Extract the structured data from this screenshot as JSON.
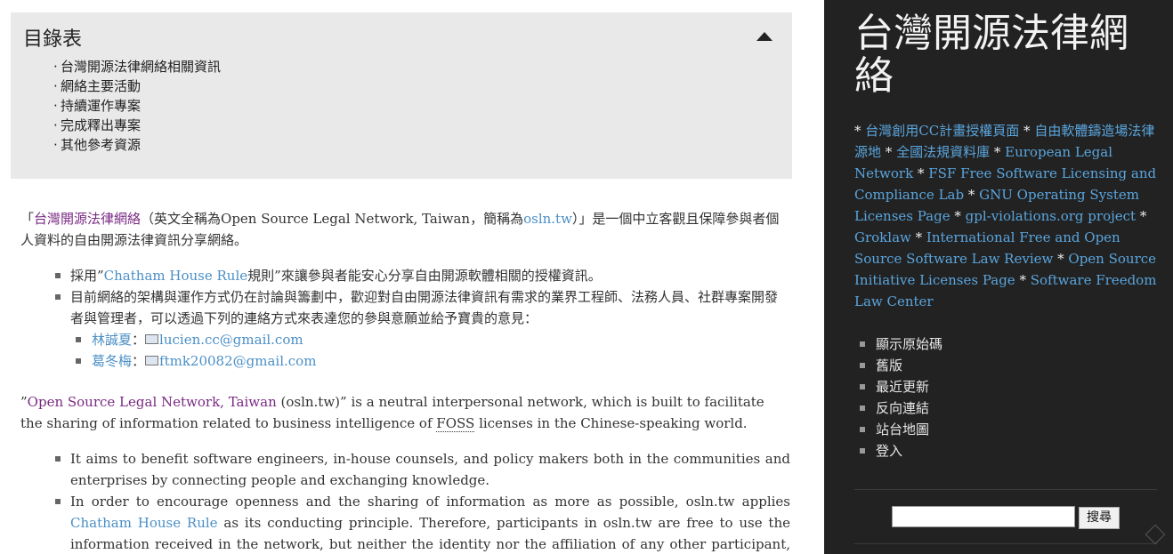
{
  "toc": {
    "title": "目錄表",
    "items": [
      "台灣開源法律網絡相關資訊",
      "網絡主要活動",
      "持續運作專案",
      "完成釋出專案",
      "其他參考資源"
    ]
  },
  "intro_zh": {
    "open_quote": "「",
    "name_link": "台灣開源法律網絡",
    "mid": "（英文全稱為Open Source Legal Network, Taiwan，簡稱為",
    "short_link": "osln.tw",
    "end": "）」是一個中立客觀且保障參與者個人資料的自由開源法律資訊分享網絡。"
  },
  "list_zh": {
    "item1_pre": "採用”",
    "item1_link": "Chatham House Rule",
    "item1_post": "規則”來讓參與者能安心分享自由開源軟體相關的授權資訊。",
    "item2": "目前網絡的架構與運作方式仍在討論與籌劃中，歡迎對自由開源法律資訊有需求的業界工程師、法務人員、社群專案開發者與管理者，可以透過下列的連絡方式來表達您的參與意願並給予寶貴的意見：",
    "contacts": [
      {
        "name": "林誠夏",
        "sep": "：",
        "email": "lucien.cc@gmail.com"
      },
      {
        "name": "葛冬梅",
        "sep": "：",
        "email": "ftmk20082@gmail.com"
      }
    ]
  },
  "intro_en": {
    "open_quote": "”",
    "name_link": "Open Source Legal Network, Taiwan",
    "rest_1": " (osln.tw)” is a neutral interpersonal network, which is built to facilitate the sharing of information related to business intelligence of ",
    "foss": "FOSS",
    "rest_2": " licenses in the Chinese-speaking world."
  },
  "list_en": {
    "item1": "It aims to benefit software engineers, in-house counsels, and policy makers both in the communities and enterprises by connecting people and exchanging knowledge.",
    "item2_pre": "In order to encourage openness and the sharing of information as more as possible, osln.tw applies ",
    "item2_link": "Chatham House Rule",
    "item2_post": " as its conducting principle. Therefore, participants in osln.tw are free to use the information received in the network, but neither the identity nor the affiliation of any other participant, may be revealed."
  },
  "sidebar": {
    "site_title": "台灣開源法律網絡",
    "bullet": "* ",
    "links": [
      "台灣創用CC計畫授權頁面",
      "自由軟體鑄造場法律源地",
      "全國法規資料庫",
      "European Legal Network",
      "FSF Free Software Licensing and Compliance Lab",
      "GNU Operating System Licenses Page",
      "gpl-violations.org project",
      "Groklaw",
      "International Free and Open Source Software Law Review",
      "Open Source Initiative Licenses Page",
      "Software Freedom Law Center"
    ],
    "menu": [
      "顯示原始碼",
      "舊版",
      "最近更新",
      "反向連結",
      "站台地圖",
      "登入"
    ],
    "search_button": "搜尋",
    "search_value": ""
  },
  "colors": {
    "sidebar_bg": "#222222",
    "link_blue": "#4a8fc7",
    "link_purple": "#7a2a84",
    "toc_bg": "#e9e9e9"
  }
}
